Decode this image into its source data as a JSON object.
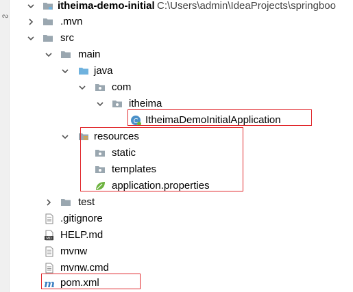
{
  "side_strip": {
    "text": "ᔓ"
  },
  "tree": {
    "root": {
      "label": "itheima-demo-initial",
      "path": "C:\\Users\\admin\\IdeaProjects\\springboo"
    },
    "items": [
      {
        "label": ".mvn"
      },
      {
        "label": "src"
      },
      {
        "label": "main"
      },
      {
        "label": "java"
      },
      {
        "label": "com"
      },
      {
        "label": "itheima"
      },
      {
        "label": "ItheimaDemoInitialApplication"
      },
      {
        "label": "resources"
      },
      {
        "label": "static"
      },
      {
        "label": "templates"
      },
      {
        "label": "application.properties"
      },
      {
        "label": "test"
      },
      {
        "label": ".gitignore"
      },
      {
        "label": "HELP.md"
      },
      {
        "label": "mvnw"
      },
      {
        "label": "mvnw.cmd"
      },
      {
        "label": "pom.xml"
      }
    ]
  },
  "icons": {
    "folder": "folder-icon",
    "module": "module-folder-icon",
    "source_root": "source-root-icon",
    "package": "package-icon",
    "resources_root": "resources-root-icon",
    "spring_props": "spring-leaf-icon",
    "class": "spring-boot-class-icon",
    "text_file": "text-file-icon",
    "markdown": "markdown-file-icon",
    "maven": "maven-pom-icon"
  },
  "colors": {
    "highlight": "#e0262a",
    "folder_gray": "#9aa7b0",
    "source_blue": "#6fb2de",
    "spring_green": "#6db33f"
  }
}
